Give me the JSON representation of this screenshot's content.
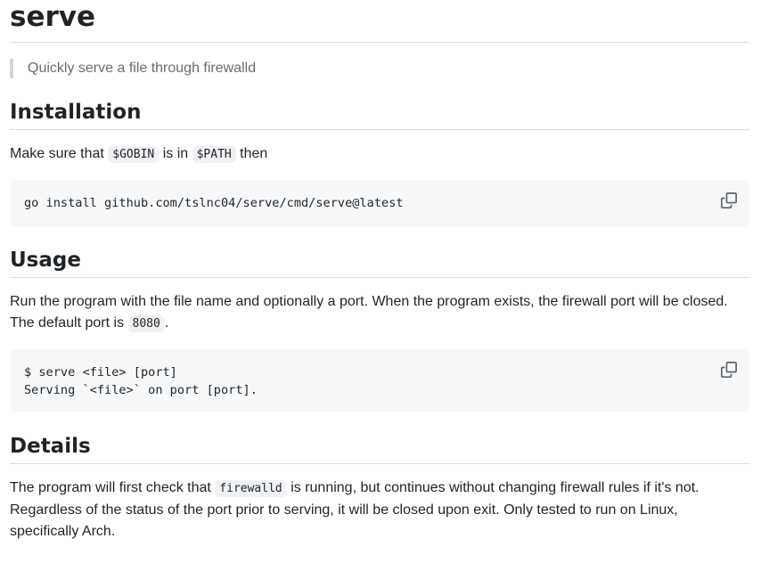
{
  "title": "serve",
  "tagline": "Quickly serve a file through firewalld",
  "installation": {
    "heading": "Installation",
    "text_before": "Make sure that ",
    "code1": "$GOBIN",
    "text_mid": " is in ",
    "code2": "$PATH",
    "text_after": " then",
    "command": "go install github.com/tslnc04/serve/cmd/serve@latest"
  },
  "usage": {
    "heading": "Usage",
    "text": "Run the program with the file name and optionally a port. When the program exists, the firewall port will be closed. The default port is ",
    "port_code": "8080",
    "text_end": ".",
    "code_line1": "$ serve <file> [port]",
    "code_line2": "Serving `<file>` on port [port]."
  },
  "details": {
    "heading": "Details",
    "text_before": "The program will first check that ",
    "code": "firewalld",
    "text_after": " is running, but continues without changing firewall rules if it's not. Regardless of the status of the port prior to serving, it will be closed upon exit. Only tested to run on Linux, specifically Arch."
  },
  "icons": {
    "copy": "copy-icon"
  }
}
